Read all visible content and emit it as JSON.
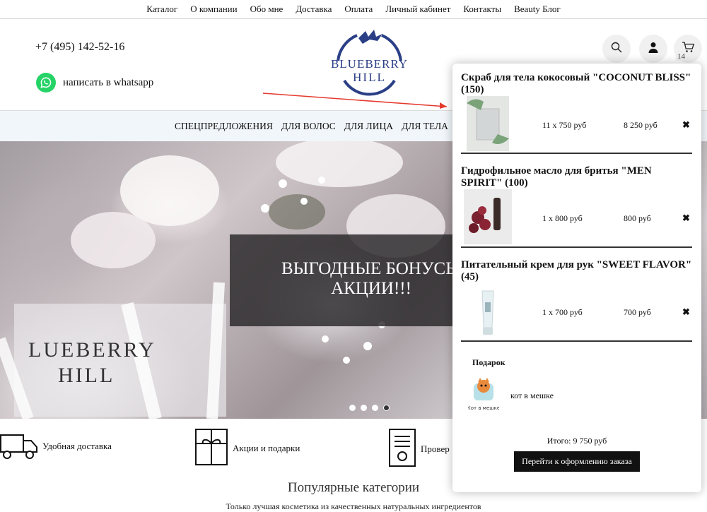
{
  "topnav": [
    "Каталог",
    "О компании",
    "Обо мне",
    "Доставка",
    "Оплата",
    "Личный кабинет",
    "Контакты",
    "Beauty Блог"
  ],
  "header": {
    "phone": "+7 (495) 142-52-16",
    "whatsapp_label": "написать в whatsapp",
    "logo_line1": "BLUEBERRY",
    "logo_line2": "HILL",
    "cart_count": "14"
  },
  "catnav": [
    "СПЕЦПРЕДЛОЖЕНИЯ",
    "ДЛЯ ВОЛОС",
    "ДЛЯ ЛИЦА",
    "ДЛЯ ТЕЛА",
    "ДЛ"
  ],
  "hero": {
    "line1": "ВЫГОДНЫЕ БОНУСЫ",
    "line2": "АКЦИИ!!!",
    "brand_line1": "LUEBERRY",
    "brand_line2": "HILL"
  },
  "features": [
    {
      "label": "Удобная доставка",
      "icon": "truck-icon"
    },
    {
      "label": "Акции и подарки",
      "icon": "gift-box-icon"
    },
    {
      "label": "Провер",
      "icon": "certificate-icon"
    }
  ],
  "section": {
    "title": "Популярные категории",
    "subtitle": "Только лучшая косметика из качественных натуральных ингредиентов"
  },
  "cart": {
    "items": [
      {
        "title": "Скраб для тела кокосовый \"COCONUT BLISS\" (150)",
        "qty": "11 x 750 руб",
        "sum": "8 250 руб"
      },
      {
        "title": "Гидрофильное масло для бритья \"MEN SPIRIT\" (100)",
        "qty": "1 x 800 руб",
        "sum": "800 руб"
      },
      {
        "title": "Питательный крем для рук \"SWEET FLAVOR\" (45)",
        "qty": "1 x 700 руб",
        "sum": "700 руб"
      }
    ],
    "delete_glyph": "✖",
    "gift_title": "Подарок",
    "gift_name": "кот в мешке",
    "gift_caption": "Кот в мешке",
    "total": "Итого: 9 750 руб",
    "checkout": "Перейти к оформлению заказа"
  },
  "colors": {
    "accent_annotation": "#e53a2e",
    "whatsapp": "#25d366",
    "logo_blue": "#2a3f86",
    "catnav_bg": "#f1f6fa"
  }
}
